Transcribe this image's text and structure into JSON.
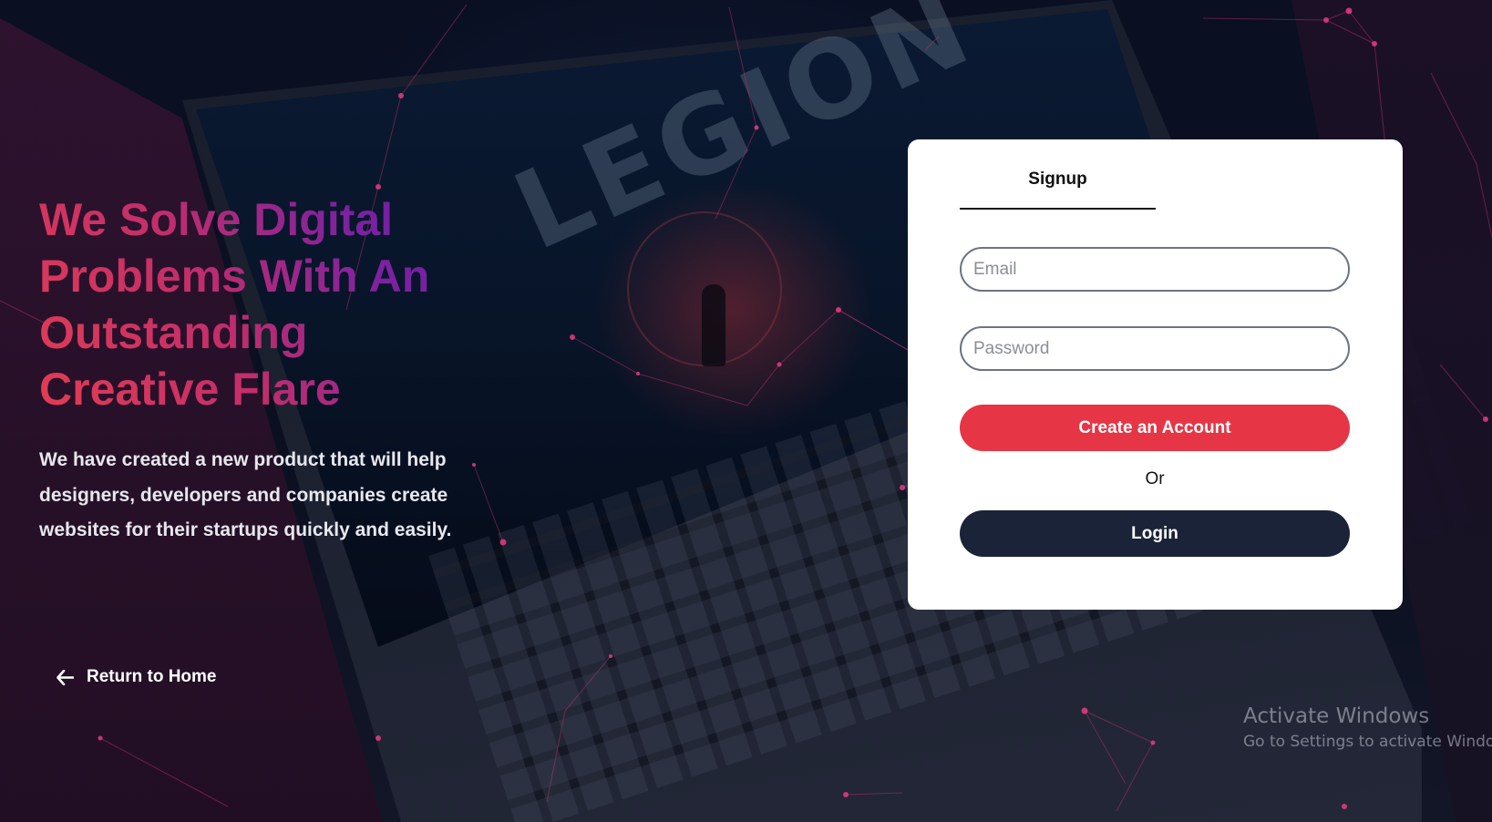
{
  "hero": {
    "title_lines": [
      "We Solve Digital",
      "Problems With An",
      "Outstanding",
      "Creative Flare"
    ],
    "subtitle_lines": [
      "We have created a new product that will help",
      "designers, developers and companies create",
      "websites for their startups quickly and easily."
    ]
  },
  "return_link": {
    "label": "Return to Home",
    "icon": "arrow-left-icon"
  },
  "signup_card": {
    "tab_label": "Signup",
    "email_placeholder": "Email",
    "email_value": "",
    "password_placeholder": "Password",
    "password_value": "",
    "create_button_label": "Create an Account",
    "or_label": "Or",
    "login_button_label": "Login"
  },
  "background": {
    "laptop_logo_text": "LEGION"
  },
  "watermark": {
    "title": "Activate Windows",
    "subtitle": "Go to Settings to activate Windows."
  },
  "colors": {
    "accent_red": "#e63544",
    "login_navy": "#1b2338",
    "title_gradient_start": "#e23d52",
    "title_gradient_end": "#6a1fa7"
  }
}
